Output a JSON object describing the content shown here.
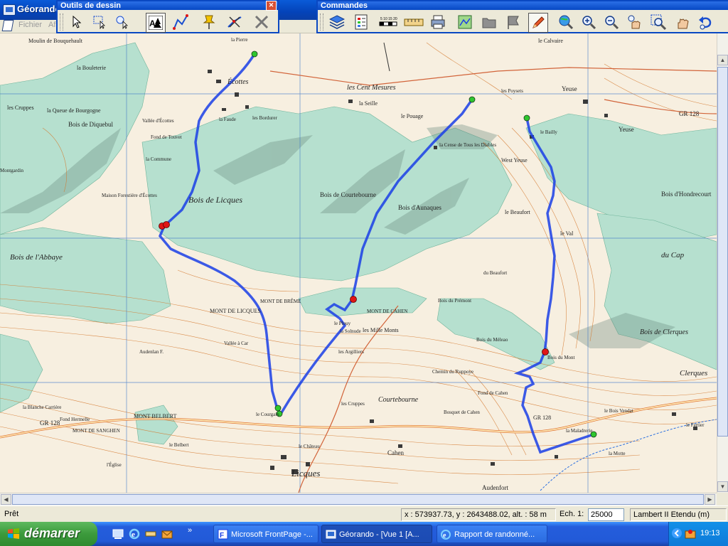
{
  "app": {
    "title": "Géorando"
  },
  "menubar": {
    "items": [
      "Fichier",
      "Af"
    ]
  },
  "drawing_toolbar": {
    "title": "Outils de dessin",
    "tools": [
      "pointer-icon",
      "select-rect-icon",
      "zoom-select-icon",
      "text-symbol-icon",
      "draw-route-icon",
      "pushpin-icon",
      "route-edit-icon",
      "delete-icon"
    ]
  },
  "commands_toolbar": {
    "title": "Commandes",
    "tools": [
      "layers-icon",
      "legend-icon",
      "scale-bar-icon",
      "ruler-icon",
      "print-icon",
      "export-map-icon",
      "folder-icon",
      "flag-icon",
      "pencil-icon",
      "globe-zoom-icon",
      "zoom-in-icon",
      "zoom-out-icon",
      "hand-zoom-icon",
      "zoom-window-icon",
      "pan-hand-icon",
      "undo-icon"
    ]
  },
  "map": {
    "labels": [
      "Moulin de Bouquehault",
      "la Bouleterie",
      "la Pierre",
      "Écottes",
      "les Cent Mesures",
      "le Calvaire",
      "Yeuse",
      "les Cruppes",
      "la Queue de Bourgogne",
      "Bois de Diquebul",
      "Vallée d'Écottes",
      "Fond de Touvet",
      "la Faude",
      "les Bordurer",
      "la Seille",
      "le Pouage",
      "les Poysets",
      "le Bailly",
      "GR 128",
      "Yeuse",
      "Montgardin",
      "la Commune",
      "la Cense de Tous les Diables",
      "West Yeuse",
      "Bois de Licques",
      "Bois de Courtebourne",
      "Bois d'Aunaques",
      "Maison Forestière d'Écottes",
      "le Beaufort",
      "le Val",
      "Bois d'Hondrecourt",
      "Bois de l'Abbaye",
      "du Beaufort",
      "Bois du Prémont",
      "du Cap",
      "MONT DE BRÊME",
      "MONT DE LICQUES",
      "MONT DE CAHEN",
      "le Plouy",
      "Bois du Mont",
      "Bois de Clerques",
      "les Mille Monts",
      "la Solnude",
      "Vallée à Car",
      "Audenlan F.",
      "les Argilliers",
      "Courtebourne",
      "Clerques",
      "GR 128",
      "la Blanche Carrière",
      "MONT BELBERT",
      "MONT DE SANGHEN",
      "le Belbert",
      "le Courgain",
      "les Cruppes",
      "le Château",
      "la Maladrerie",
      "Fond Hermelle",
      "l'Église",
      "Licques",
      "Cahen",
      "Audenfort",
      "la Motte",
      "Chemin du Ruppoye",
      "Fond de Cahen",
      "Bosquet de Cahen",
      "Bois du Méleao",
      "le Bois Vendat",
      "GR 128",
      "le Fertier"
    ]
  },
  "status": {
    "ready": "Prêt",
    "coords": "x : 573937.73, y : 2643488.02, alt. : 58 m",
    "scale_label": "Ech. 1:",
    "scale_value": "25000",
    "projection": "Lambert II Etendu (m)"
  },
  "taskbar": {
    "start_label": "démarrer",
    "tasks": [
      {
        "label": "Microsoft FrontPage -..."
      },
      {
        "label": "Géorando - [Vue 1 [A..."
      },
      {
        "label": "Rapport de randonné..."
      }
    ],
    "clock": "19:13"
  },
  "colors": {
    "route": "#1a3ee6",
    "forest": "#b6e0cf",
    "contour": "#d4782d",
    "titlebar": "#0a5bd8",
    "taskbar": "#245ddc"
  }
}
